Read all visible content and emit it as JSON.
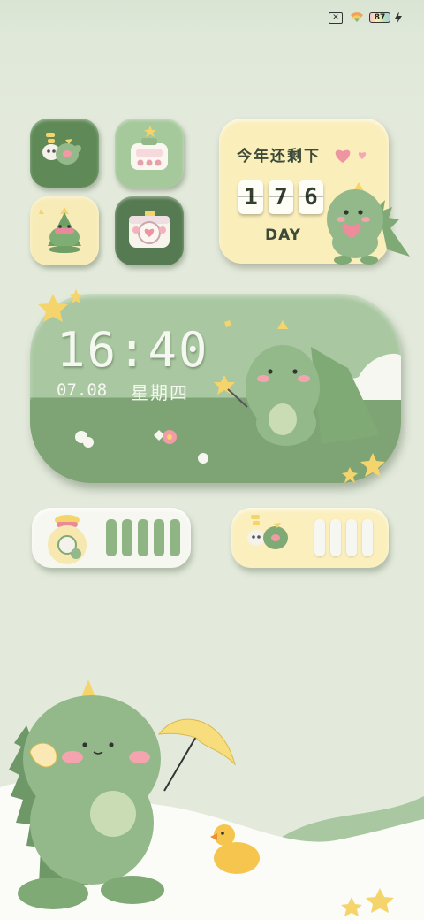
{
  "status_bar": {
    "sim_icon": "sim-off-icon",
    "wifi_icon": "wifi-icon",
    "battery_level": "87",
    "charging_icon": "charging-bolt-icon"
  },
  "apps": [
    {
      "icon": "dino-chat-icon",
      "color": "#5f8a57"
    },
    {
      "icon": "dino-toaster-icon",
      "color": "#9fc496"
    },
    {
      "icon": "dino-tree-icon",
      "color": "#f7ecb8"
    },
    {
      "icon": "dino-camera-icon",
      "color": "#567a51"
    }
  ],
  "countdown": {
    "title": "今年还剩下",
    "digits": [
      "1",
      "7",
      "6"
    ],
    "unit": "DAY"
  },
  "clock": {
    "time": "16:40",
    "date": "07.08",
    "weekday": "星期四"
  },
  "bars_widgets": [
    {
      "icon": "money-bag-icon",
      "background": "#f7f7f2",
      "bar_color": "#8fb585",
      "bars": 5
    },
    {
      "icon": "dino-chat-icon",
      "background": "#faefbd",
      "bar_color": "#f7f7f2",
      "bars": 4
    }
  ],
  "colors": {
    "background": "#e3eadc",
    "dino_green": "#93b98a",
    "accent_yellow": "#f5d56b",
    "pink": "#f09aa6"
  }
}
